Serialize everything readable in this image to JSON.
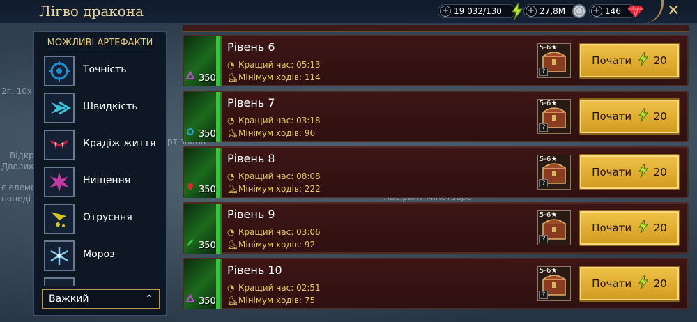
{
  "header": {
    "title": "Лігво дракона",
    "energy": "19 032/130",
    "silver": "27,8M",
    "gems": "146"
  },
  "background_text": {
    "t1": "2г. 10х",
    "t2": "Відкр",
    "t3": "Дволик",
    "t4": "рт знань",
    "t5": "є елеме",
    "t6": "понеді",
    "t7": "Лабіринт Мінотавра"
  },
  "panel": {
    "title": "МОЖЛИВІ АРТЕФАКТИ",
    "artifacts": [
      {
        "name": "Точність",
        "icon": "accuracy-icon",
        "color": "#1f8fd1"
      },
      {
        "name": "Швидкість",
        "icon": "speed-icon",
        "color": "#3ac2d6"
      },
      {
        "name": "Крадіж життя",
        "icon": "lifesteal-icon",
        "color": "#c0203a"
      },
      {
        "name": "Нищення",
        "icon": "destroy-icon",
        "color": "#c23aa0"
      },
      {
        "name": "Отруєння",
        "icon": "poison-icon",
        "color": "#d9c51a"
      },
      {
        "name": "Мороз",
        "icon": "frost-icon",
        "color": "#7fc9ef"
      }
    ],
    "difficulty": "Важкий"
  },
  "levels": [
    {
      "name": "Рівень 6",
      "best_label": "Кращий час: 05:13",
      "moves_label": "Мінімум ходів: 114",
      "power": "350",
      "reward": "5-6★",
      "start": "Почати",
      "cost": "20",
      "affinity": "triangle"
    },
    {
      "name": "Рівень 7",
      "best_label": "Кращий час: 03:18",
      "moves_label": "Мінімум ходів: 96",
      "power": "350",
      "reward": "5-6★",
      "start": "Почати",
      "cost": "20",
      "affinity": "magic"
    },
    {
      "name": "Рівень 8",
      "best_label": "Кращий час: 08:08",
      "moves_label": "Мінімум ходів: 222",
      "power": "350",
      "reward": "5-6★",
      "start": "Почати",
      "cost": "20",
      "affinity": "skull"
    },
    {
      "name": "Рівень 9",
      "best_label": "Кращий час: 03:06",
      "moves_label": "Мінімум ходів: 92",
      "power": "350",
      "reward": "5-6★",
      "start": "Почати",
      "cost": "20",
      "affinity": "leaf"
    },
    {
      "name": "Рівень 10",
      "best_label": "Кращий час: 02:51",
      "moves_label": "Мінімум ходів: 75",
      "power": "350",
      "reward": "5-6★",
      "start": "Почати",
      "cost": "20",
      "affinity": "triangle"
    }
  ],
  "colors": {
    "accent_gold": "#e6c97b",
    "button_gold": "#f0c24a",
    "row_bg": "#3d1515",
    "stat_text": "#e2c66a"
  }
}
